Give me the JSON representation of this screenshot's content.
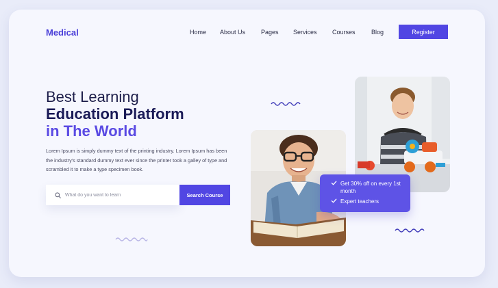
{
  "header": {
    "logo": "Medical",
    "nav": [
      {
        "label": "Home"
      },
      {
        "label": "About Us"
      },
      {
        "label": "Pages"
      },
      {
        "label": "Services"
      },
      {
        "label": "Courses"
      },
      {
        "label": "Blog"
      }
    ],
    "register_label": "Register"
  },
  "hero": {
    "title_line1": "Best Learning",
    "title_line2": "Education Platform",
    "title_line3": "in The World",
    "description": "Lorem Ipsum is simply dummy text of the printing industry. Lorem Ipsum has been the industry's standard dummy text ever since the printer took a galley of type and scrambled it to make a type specimen book."
  },
  "search": {
    "placeholder": "What do you want to learn",
    "value": "",
    "button_label": "Search Course",
    "icon": "search-icon"
  },
  "badge": {
    "items": [
      {
        "icon": "check-icon",
        "text": "Get 30% off on every 1st month"
      },
      {
        "icon": "check-icon",
        "text": "Expert teachers"
      }
    ]
  },
  "colors": {
    "accent": "#5146e3",
    "title_dark": "#1b1b57",
    "title_accent": "#5a4ae3",
    "background": "#f6f7fe"
  }
}
